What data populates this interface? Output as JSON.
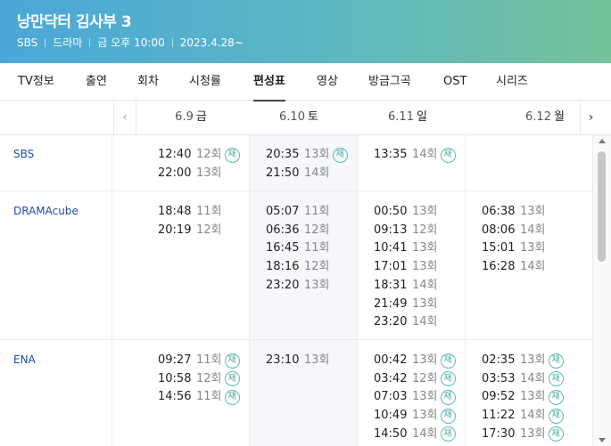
{
  "header": {
    "title": "낭만닥터 김사부 3",
    "meta": [
      "SBS",
      "드라마",
      "금 오후 10:00",
      "2023.4.28~"
    ]
  },
  "tabs": [
    {
      "label": "TV정보"
    },
    {
      "label": "출연"
    },
    {
      "label": "회차"
    },
    {
      "label": "시청률"
    },
    {
      "label": "편성표",
      "active": true
    },
    {
      "label": "영상"
    },
    {
      "label": "방금그곡"
    },
    {
      "label": "OST"
    },
    {
      "label": "시리즈"
    }
  ],
  "dates": [
    {
      "date": "6.9",
      "weekday": "금"
    },
    {
      "date": "6.10",
      "weekday": "토"
    },
    {
      "date": "6.11",
      "weekday": "일"
    },
    {
      "date": "6.12",
      "weekday": "월"
    }
  ],
  "nav": {
    "prev": "‹",
    "next": "›"
  },
  "rerun_mark": "재",
  "channels": [
    {
      "name": "SBS",
      "days": [
        [
          {
            "time": "12:40",
            "ep": "12회",
            "re": true
          },
          {
            "time": "22:00",
            "ep": "13회",
            "re": false
          }
        ],
        [
          {
            "time": "20:35",
            "ep": "13회",
            "re": true
          },
          {
            "time": "21:50",
            "ep": "14회",
            "re": false
          }
        ],
        [
          {
            "time": "13:35",
            "ep": "14회",
            "re": true
          }
        ],
        []
      ]
    },
    {
      "name": "DRAMAcube",
      "days": [
        [
          {
            "time": "18:48",
            "ep": "11회",
            "re": false
          },
          {
            "time": "20:19",
            "ep": "12회",
            "re": false
          }
        ],
        [
          {
            "time": "05:07",
            "ep": "11회",
            "re": false
          },
          {
            "time": "06:36",
            "ep": "12회",
            "re": false
          },
          {
            "time": "16:45",
            "ep": "11회",
            "re": false
          },
          {
            "time": "18:16",
            "ep": "12회",
            "re": false
          },
          {
            "time": "23:20",
            "ep": "13회",
            "re": false
          }
        ],
        [
          {
            "time": "00:50",
            "ep": "13회",
            "re": false
          },
          {
            "time": "09:13",
            "ep": "12회",
            "re": false
          },
          {
            "time": "10:41",
            "ep": "13회",
            "re": false
          },
          {
            "time": "17:01",
            "ep": "13회",
            "re": false
          },
          {
            "time": "18:31",
            "ep": "14회",
            "re": false
          },
          {
            "time": "21:49",
            "ep": "13회",
            "re": false
          },
          {
            "time": "23:20",
            "ep": "14회",
            "re": false
          }
        ],
        [
          {
            "time": "06:38",
            "ep": "13회",
            "re": false
          },
          {
            "time": "08:06",
            "ep": "14회",
            "re": false
          },
          {
            "time": "15:01",
            "ep": "13회",
            "re": false
          },
          {
            "time": "16:28",
            "ep": "14회",
            "re": false
          }
        ]
      ]
    },
    {
      "name": "ENA",
      "days": [
        [
          {
            "time": "09:27",
            "ep": "11회",
            "re": true
          },
          {
            "time": "10:58",
            "ep": "12회",
            "re": true
          },
          {
            "time": "14:56",
            "ep": "11회",
            "re": true
          }
        ],
        [
          {
            "time": "23:10",
            "ep": "13회",
            "re": false
          }
        ],
        [
          {
            "time": "00:42",
            "ep": "13회",
            "re": true
          },
          {
            "time": "03:42",
            "ep": "12회",
            "re": true
          },
          {
            "time": "07:03",
            "ep": "13회",
            "re": true
          },
          {
            "time": "10:49",
            "ep": "13회",
            "re": true
          },
          {
            "time": "14:50",
            "ep": "14회",
            "re": true
          }
        ],
        [
          {
            "time": "02:35",
            "ep": "13회",
            "re": true
          },
          {
            "time": "03:53",
            "ep": "14회",
            "re": true
          },
          {
            "time": "09:52",
            "ep": "13회",
            "re": true
          },
          {
            "time": "11:22",
            "ep": "14회",
            "re": true
          },
          {
            "time": "17:30",
            "ep": "13회",
            "re": true
          }
        ]
      ]
    }
  ]
}
